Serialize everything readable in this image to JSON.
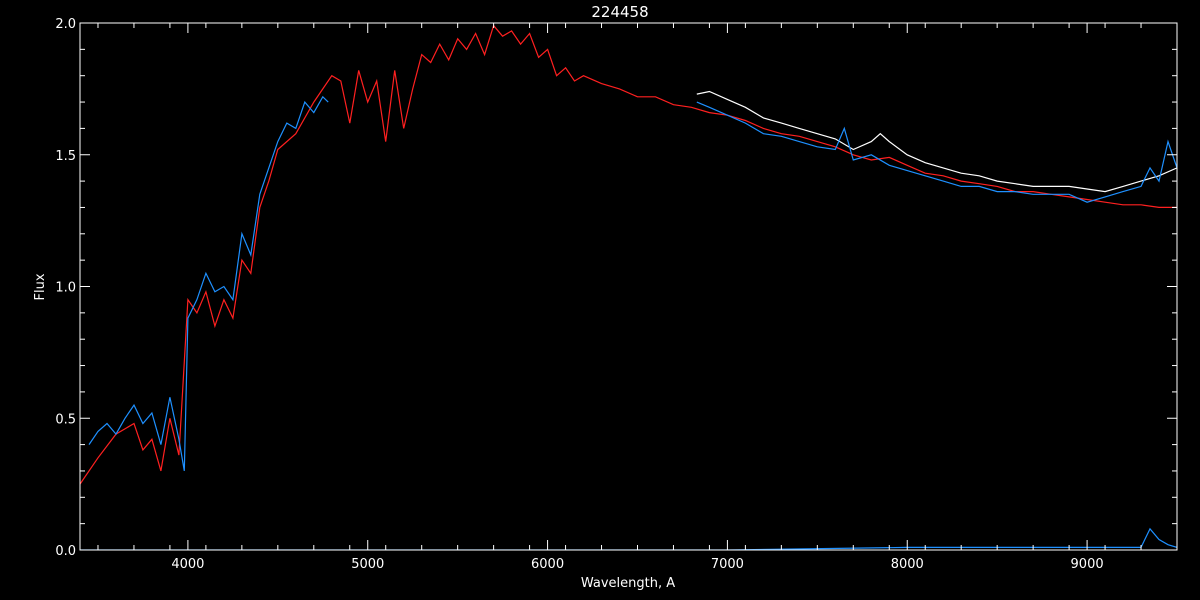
{
  "chart_data": {
    "type": "line",
    "title": "224458",
    "xlabel": "Wavelength, A",
    "ylabel": "Flux",
    "xlim": [
      3400,
      9500
    ],
    "ylim": [
      0.0,
      2.0
    ],
    "xticks": [
      {
        "value": 4000,
        "label": "4000"
      },
      {
        "value": 5000,
        "label": "5000"
      },
      {
        "value": 6000,
        "label": "6000"
      },
      {
        "value": 7000,
        "label": "7000"
      },
      {
        "value": 8000,
        "label": "8000"
      },
      {
        "value": 9000,
        "label": "9000"
      }
    ],
    "yticks": [
      {
        "value": 0.0,
        "label": "0.0"
      },
      {
        "value": 0.5,
        "label": "0.5"
      },
      {
        "value": 1.0,
        "label": "1.0"
      },
      {
        "value": 1.5,
        "label": "1.5"
      },
      {
        "value": 2.0,
        "label": "2.0"
      }
    ],
    "background": "#000000",
    "axis_color": "#ffffff",
    "series": [
      {
        "color": "#ff2020",
        "x": [
          3400,
          3500,
          3600,
          3700,
          3750,
          3800,
          3850,
          3900,
          3950,
          4000,
          4050,
          4100,
          4150,
          4200,
          4250,
          4300,
          4350,
          4400,
          4450,
          4500,
          4600,
          4700,
          4750,
          4800,
          4850,
          4900,
          4950,
          5000,
          5050,
          5100,
          5150,
          5200,
          5250,
          5300,
          5350,
          5400,
          5450,
          5500,
          5550,
          5600,
          5650,
          5700,
          5750,
          5800,
          5850,
          5900,
          5950,
          6000,
          6050,
          6100,
          6150,
          6200,
          6300,
          6400,
          6500,
          6600,
          6700,
          6800,
          6900,
          7000,
          7100,
          7200,
          7300,
          7400,
          7500,
          7600,
          7700,
          7800,
          7900,
          8000,
          8100,
          8200,
          8300,
          8400,
          8500,
          8600,
          8700,
          8800,
          8900,
          9000,
          9100,
          9200,
          9300,
          9400,
          9500
        ],
        "y": [
          0.25,
          0.35,
          0.44,
          0.48,
          0.38,
          0.42,
          0.3,
          0.5,
          0.36,
          0.95,
          0.9,
          0.98,
          0.85,
          0.95,
          0.88,
          1.1,
          1.05,
          1.3,
          1.4,
          1.52,
          1.58,
          1.7,
          1.75,
          1.8,
          1.78,
          1.62,
          1.82,
          1.7,
          1.78,
          1.55,
          1.82,
          1.6,
          1.75,
          1.88,
          1.85,
          1.92,
          1.86,
          1.94,
          1.9,
          1.96,
          1.88,
          1.99,
          1.95,
          1.97,
          1.92,
          1.96,
          1.87,
          1.9,
          1.8,
          1.83,
          1.78,
          1.8,
          1.77,
          1.75,
          1.72,
          1.72,
          1.69,
          1.68,
          1.66,
          1.65,
          1.63,
          1.6,
          1.58,
          1.57,
          1.55,
          1.53,
          1.5,
          1.48,
          1.49,
          1.46,
          1.43,
          1.42,
          1.4,
          1.39,
          1.38,
          1.36,
          1.36,
          1.35,
          1.34,
          1.33,
          1.32,
          1.31,
          1.31,
          1.3,
          1.3
        ]
      },
      {
        "color": "#ffffff",
        "x": [
          6830,
          6900,
          7000,
          7100,
          7200,
          7300,
          7400,
          7500,
          7600,
          7700,
          7800,
          7850,
          7900,
          8000,
          8100,
          8200,
          8300,
          8400,
          8500,
          8600,
          8700,
          8800,
          8900,
          9000,
          9100,
          9200,
          9300,
          9400,
          9500
        ],
        "y": [
          1.73,
          1.74,
          1.71,
          1.68,
          1.64,
          1.62,
          1.6,
          1.58,
          1.56,
          1.52,
          1.55,
          1.58,
          1.55,
          1.5,
          1.47,
          1.45,
          1.43,
          1.42,
          1.4,
          1.39,
          1.38,
          1.38,
          1.38,
          1.37,
          1.36,
          1.38,
          1.4,
          1.42,
          1.45
        ]
      },
      {
        "color": "#1e90ff",
        "x": [
          3450,
          3500,
          3550,
          3600,
          3650,
          3700,
          3750,
          3800,
          3850,
          3900,
          3950,
          3980,
          4000,
          4050,
          4100,
          4150,
          4200,
          4250,
          4300,
          4350,
          4400,
          4450,
          4500,
          4550,
          4600,
          4650,
          4700,
          4750,
          4780
        ],
        "y": [
          0.4,
          0.45,
          0.48,
          0.44,
          0.5,
          0.55,
          0.48,
          0.52,
          0.4,
          0.58,
          0.42,
          0.3,
          0.88,
          0.95,
          1.05,
          0.98,
          1.0,
          0.95,
          1.2,
          1.12,
          1.35,
          1.45,
          1.55,
          1.62,
          1.6,
          1.7,
          1.66,
          1.72,
          1.7
        ]
      },
      {
        "color": "#1e90ff",
        "x": [
          6830,
          6900,
          7000,
          7100,
          7200,
          7300,
          7400,
          7500,
          7600,
          7650,
          7700,
          7800,
          7900,
          8000,
          8100,
          8200,
          8300,
          8400,
          8500,
          8600,
          8700,
          8800,
          8900,
          9000,
          9100,
          9200,
          9300,
          9350,
          9400,
          9450,
          9500
        ],
        "y": [
          1.7,
          1.68,
          1.65,
          1.62,
          1.58,
          1.57,
          1.55,
          1.53,
          1.52,
          1.6,
          1.48,
          1.5,
          1.46,
          1.44,
          1.42,
          1.4,
          1.38,
          1.38,
          1.36,
          1.36,
          1.35,
          1.35,
          1.35,
          1.32,
          1.34,
          1.36,
          1.38,
          1.45,
          1.4,
          1.55,
          1.45
        ]
      },
      {
        "color": "#1e90ff",
        "x": [
          3400,
          4000,
          5000,
          6000,
          7000,
          8000,
          9000,
          9300,
          9350,
          9400,
          9450,
          9500
        ],
        "y": [
          0.0,
          0.0,
          0.0,
          0.0,
          0.0,
          0.01,
          0.01,
          0.01,
          0.08,
          0.04,
          0.02,
          0.01
        ]
      }
    ]
  }
}
